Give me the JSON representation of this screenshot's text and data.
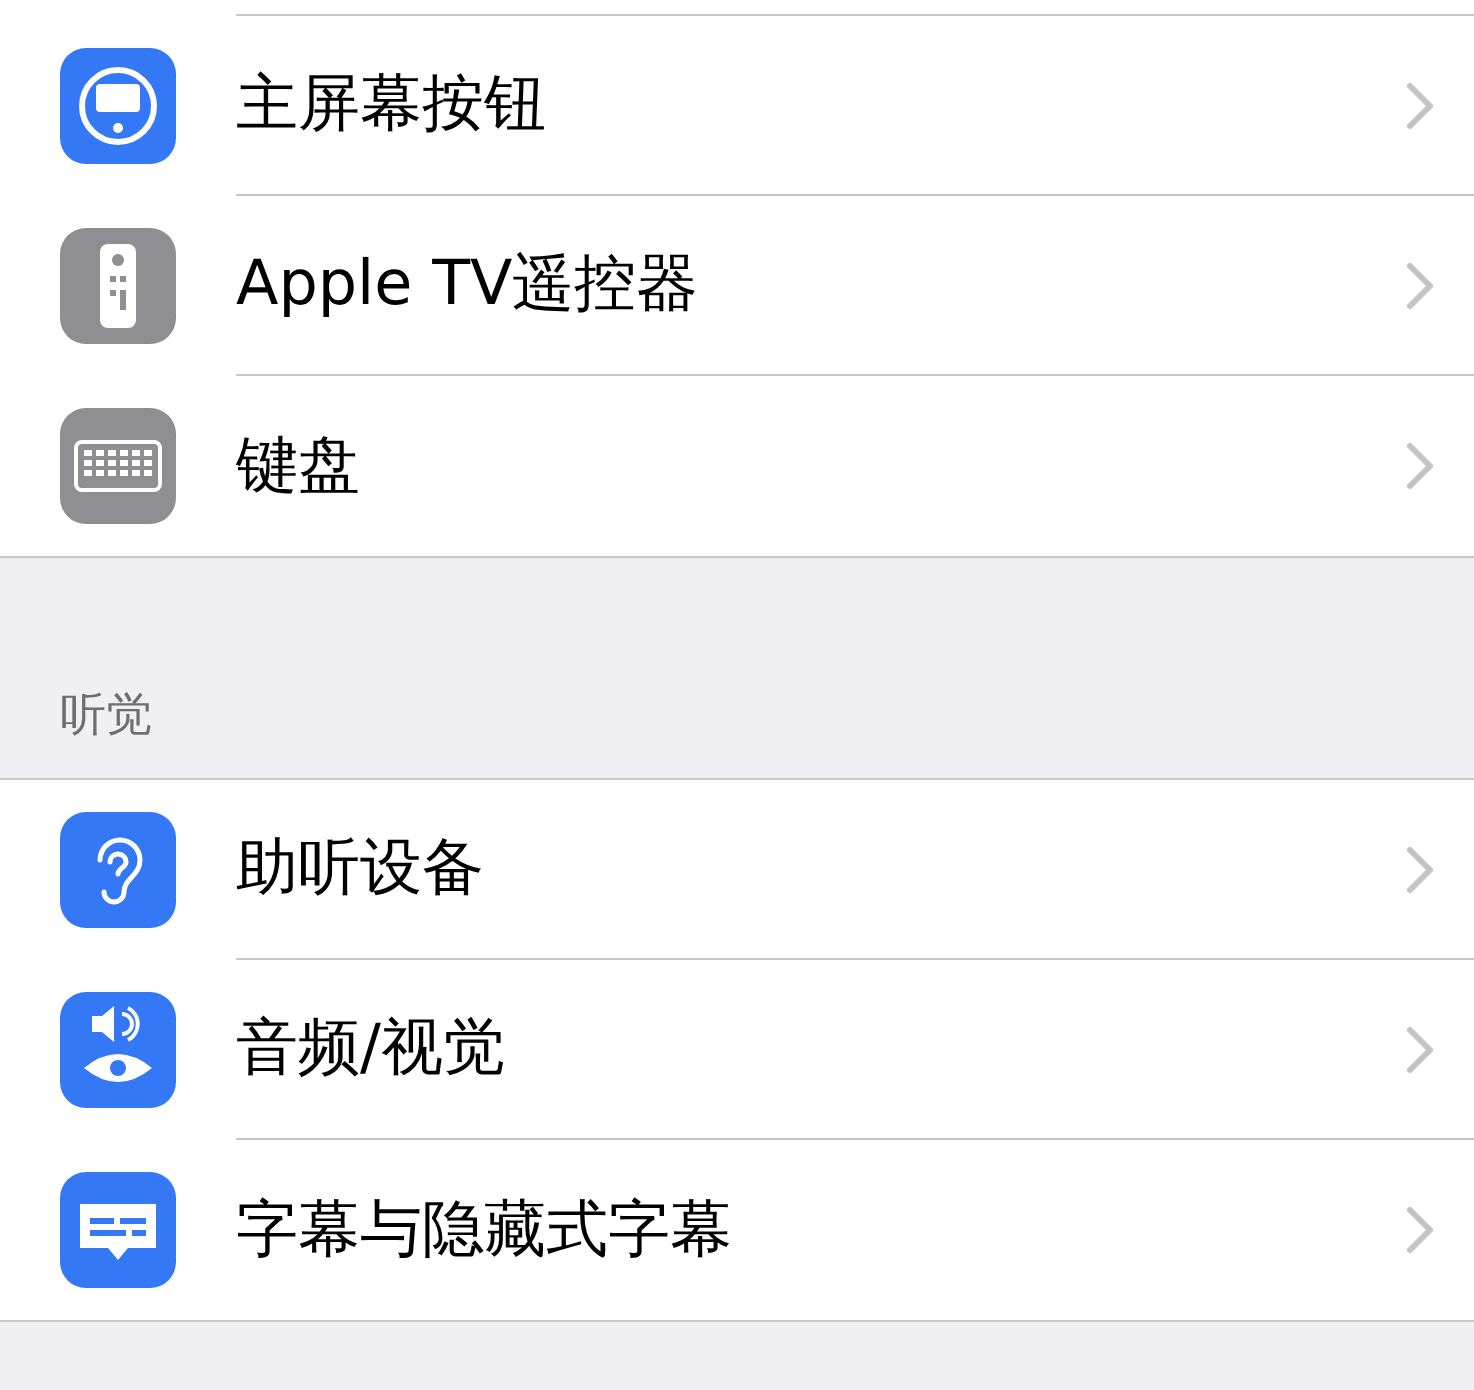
{
  "groups": [
    {
      "rows": [
        {
          "kind": "home-button",
          "label": "主屏幕按钮"
        },
        {
          "kind": "remote",
          "label": "Apple TV遥控器"
        },
        {
          "kind": "keyboard",
          "label": "键盘"
        }
      ]
    },
    {
      "header": "听觉",
      "rows": [
        {
          "kind": "hearing",
          "label": "助听设备"
        },
        {
          "kind": "audio",
          "label": "音频/视觉"
        },
        {
          "kind": "subtitles",
          "label": "字幕与隐藏式字幕"
        }
      ]
    }
  ]
}
